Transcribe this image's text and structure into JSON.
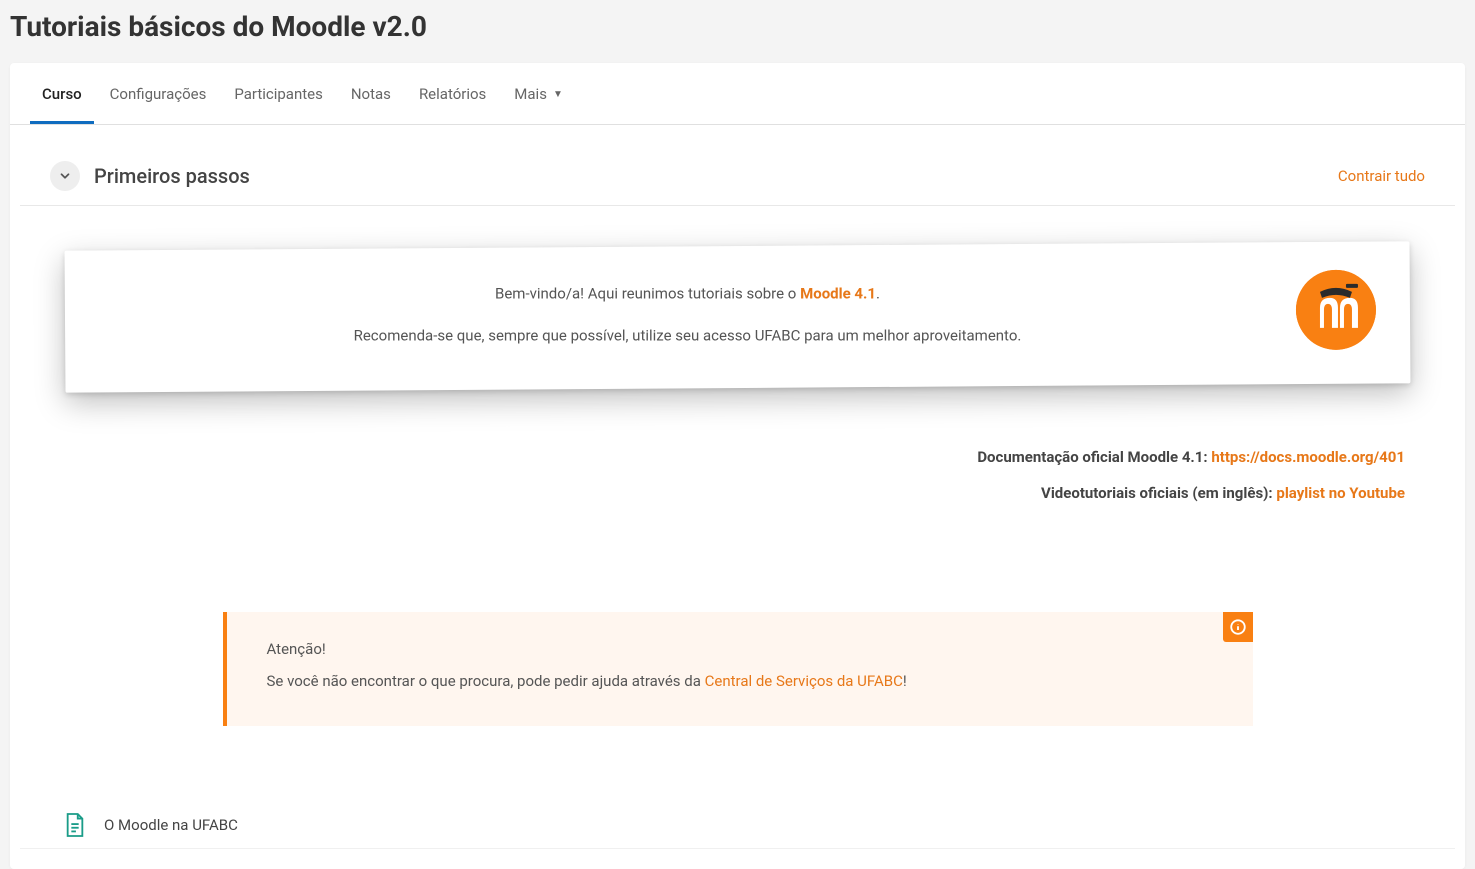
{
  "header": {
    "title": "Tutoriais básicos do Moodle v2.0"
  },
  "tabs": [
    {
      "label": "Curso",
      "name": "tab-curso",
      "active": true
    },
    {
      "label": "Configurações",
      "name": "tab-configuracoes",
      "active": false
    },
    {
      "label": "Participantes",
      "name": "tab-participantes",
      "active": false
    },
    {
      "label": "Notas",
      "name": "tab-notas",
      "active": false
    },
    {
      "label": "Relatórios",
      "name": "tab-relatorios",
      "active": false
    },
    {
      "label": "Mais",
      "name": "tab-mais",
      "active": false,
      "dropdown": true
    }
  ],
  "section": {
    "title": "Primeiros passos",
    "collapse_all": "Contrair tudo"
  },
  "welcome": {
    "text1_prefix": "Bem-vindo/a! Aqui reunimos tutoriais sobre o ",
    "text1_highlight": "Moodle 4.1",
    "text1_suffix": ".",
    "text2": "Recomenda-se que, sempre que possível, utilize seu acesso UFABC para um melhor aproveitamento."
  },
  "doc_links": {
    "line1_label": "Documentação oficial Moodle 4.1: ",
    "line1_link": "https://docs.moodle.org/401",
    "line2_label": "Videotutoriais oficiais (em inglês): ",
    "line2_link": "playlist no Youtube"
  },
  "alert": {
    "title": "Atenção!",
    "body_prefix": "Se você não encontrar o que procura, pode pedir ajuda através da ",
    "body_link": "Central de Serviços da UFABC",
    "body_suffix": "!"
  },
  "resources": [
    {
      "label": "O Moodle na UFABC"
    }
  ]
}
